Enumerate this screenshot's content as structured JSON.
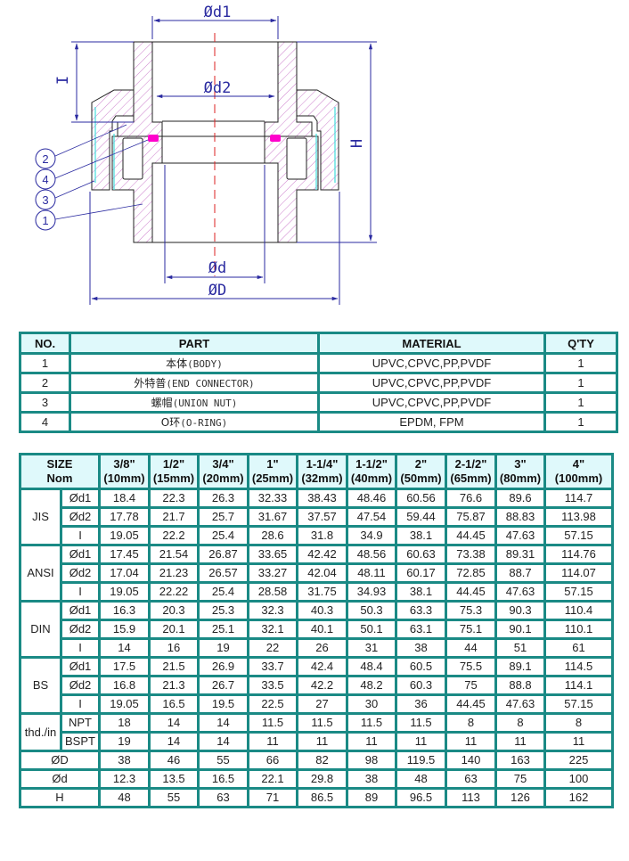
{
  "drawing": {
    "labels": {
      "d1": "Ød1",
      "d2": "Ød2",
      "d": "Ød",
      "D": "ØD",
      "H": "H",
      "I": "I"
    },
    "callouts": [
      "2",
      "4",
      "3",
      "1"
    ],
    "colors": {
      "dimension_lines": "#2a2aa0",
      "hatch": "#c060c0",
      "o_ring": "#ff00cc",
      "center_line": "#dd2222",
      "thread": "#44dddd",
      "outline": "#222222"
    }
  },
  "parts_table": {
    "headers": [
      "NO.",
      "PART",
      "MATERIAL",
      "Q'TY"
    ],
    "rows": [
      {
        "no": "1",
        "part_cn": "本体",
        "part_en": "(BODY)",
        "material": "UPVC,CPVC,PP,PVDF",
        "qty": "1"
      },
      {
        "no": "2",
        "part_cn": "外特普",
        "part_en": "(END CONNECTOR)",
        "material": "UPVC,CPVC,PP,PVDF",
        "qty": "1"
      },
      {
        "no": "3",
        "part_cn": "螺帽",
        "part_en": "(UNION NUT)",
        "material": "UPVC,CPVC,PP,PVDF",
        "qty": "1"
      },
      {
        "no": "4",
        "part_cn": "O环",
        "part_en": "(O-RING)",
        "material": "EPDM, FPM",
        "qty": "1"
      }
    ]
  },
  "dims_table": {
    "corner_line1": "SIZE",
    "corner_line2": "Nom",
    "sizes": [
      {
        "inch": "3/8\"",
        "mm": "(10mm)"
      },
      {
        "inch": "1/2\"",
        "mm": "(15mm)"
      },
      {
        "inch": "3/4\"",
        "mm": "(20mm)"
      },
      {
        "inch": "1\"",
        "mm": "(25mm)"
      },
      {
        "inch": "1-1/4\"",
        "mm": "(32mm)"
      },
      {
        "inch": "1-1/2\"",
        "mm": "(40mm)"
      },
      {
        "inch": "2\"",
        "mm": "(50mm)"
      },
      {
        "inch": "2-1/2\"",
        "mm": "(65mm)"
      },
      {
        "inch": "3\"",
        "mm": "(80mm)"
      },
      {
        "inch": "4\"",
        "mm": "(100mm)"
      }
    ],
    "groups": [
      {
        "standard": "JIS",
        "rows": [
          {
            "param": "Ød1",
            "values": [
              "18.4",
              "22.3",
              "26.3",
              "32.33",
              "38.43",
              "48.46",
              "60.56",
              "76.6",
              "89.6",
              "114.7"
            ]
          },
          {
            "param": "Ød2",
            "values": [
              "17.78",
              "21.7",
              "25.7",
              "31.67",
              "37.57",
              "47.54",
              "59.44",
              "75.87",
              "88.83",
              "113.98"
            ]
          },
          {
            "param": "I",
            "values": [
              "19.05",
              "22.2",
              "25.4",
              "28.6",
              "31.8",
              "34.9",
              "38.1",
              "44.45",
              "47.63",
              "57.15"
            ]
          }
        ]
      },
      {
        "standard": "ANSI",
        "rows": [
          {
            "param": "Ød1",
            "values": [
              "17.45",
              "21.54",
              "26.87",
              "33.65",
              "42.42",
              "48.56",
              "60.63",
              "73.38",
              "89.31",
              "114.76"
            ]
          },
          {
            "param": "Ød2",
            "values": [
              "17.04",
              "21.23",
              "26.57",
              "33.27",
              "42.04",
              "48.11",
              "60.17",
              "72.85",
              "88.7",
              "114.07"
            ]
          },
          {
            "param": "I",
            "values": [
              "19.05",
              "22.22",
              "25.4",
              "28.58",
              "31.75",
              "34.93",
              "38.1",
              "44.45",
              "47.63",
              "57.15"
            ]
          }
        ]
      },
      {
        "standard": "DIN",
        "rows": [
          {
            "param": "Ød1",
            "values": [
              "16.3",
              "20.3",
              "25.3",
              "32.3",
              "40.3",
              "50.3",
              "63.3",
              "75.3",
              "90.3",
              "110.4"
            ]
          },
          {
            "param": "Ød2",
            "values": [
              "15.9",
              "20.1",
              "25.1",
              "32.1",
              "40.1",
              "50.1",
              "63.1",
              "75.1",
              "90.1",
              "110.1"
            ]
          },
          {
            "param": "I",
            "values": [
              "14",
              "16",
              "19",
              "22",
              "26",
              "31",
              "38",
              "44",
              "51",
              "61"
            ]
          }
        ]
      },
      {
        "standard": "BS",
        "rows": [
          {
            "param": "Ød1",
            "values": [
              "17.5",
              "21.5",
              "26.9",
              "33.7",
              "42.4",
              "48.4",
              "60.5",
              "75.5",
              "89.1",
              "114.5"
            ]
          },
          {
            "param": "Ød2",
            "values": [
              "16.8",
              "21.3",
              "26.7",
              "33.5",
              "42.2",
              "48.2",
              "60.3",
              "75",
              "88.8",
              "114.1"
            ]
          },
          {
            "param": "I",
            "values": [
              "19.05",
              "16.5",
              "19.5",
              "22.5",
              "27",
              "30",
              "36",
              "44.45",
              "47.63",
              "57.15"
            ]
          }
        ]
      },
      {
        "standard": "thd./in",
        "rows": [
          {
            "param": "NPT",
            "values": [
              "18",
              "14",
              "14",
              "11.5",
              "11.5",
              "11.5",
              "11.5",
              "8",
              "8",
              "8"
            ]
          },
          {
            "param": "BSPT",
            "values": [
              "19",
              "14",
              "14",
              "11",
              "11",
              "11",
              "11",
              "11",
              "11",
              "11"
            ]
          }
        ]
      }
    ],
    "common_rows": [
      {
        "label": "ØD",
        "values": [
          "38",
          "46",
          "55",
          "66",
          "82",
          "98",
          "119.5",
          "140",
          "163",
          "225"
        ]
      },
      {
        "label": "Ød",
        "values": [
          "12.3",
          "13.5",
          "16.5",
          "22.1",
          "29.8",
          "38",
          "48",
          "63",
          "75",
          "100"
        ]
      },
      {
        "label": "H",
        "values": [
          "48",
          "55",
          "63",
          "71",
          "86.5",
          "89",
          "96.5",
          "113",
          "126",
          "162"
        ]
      }
    ]
  }
}
